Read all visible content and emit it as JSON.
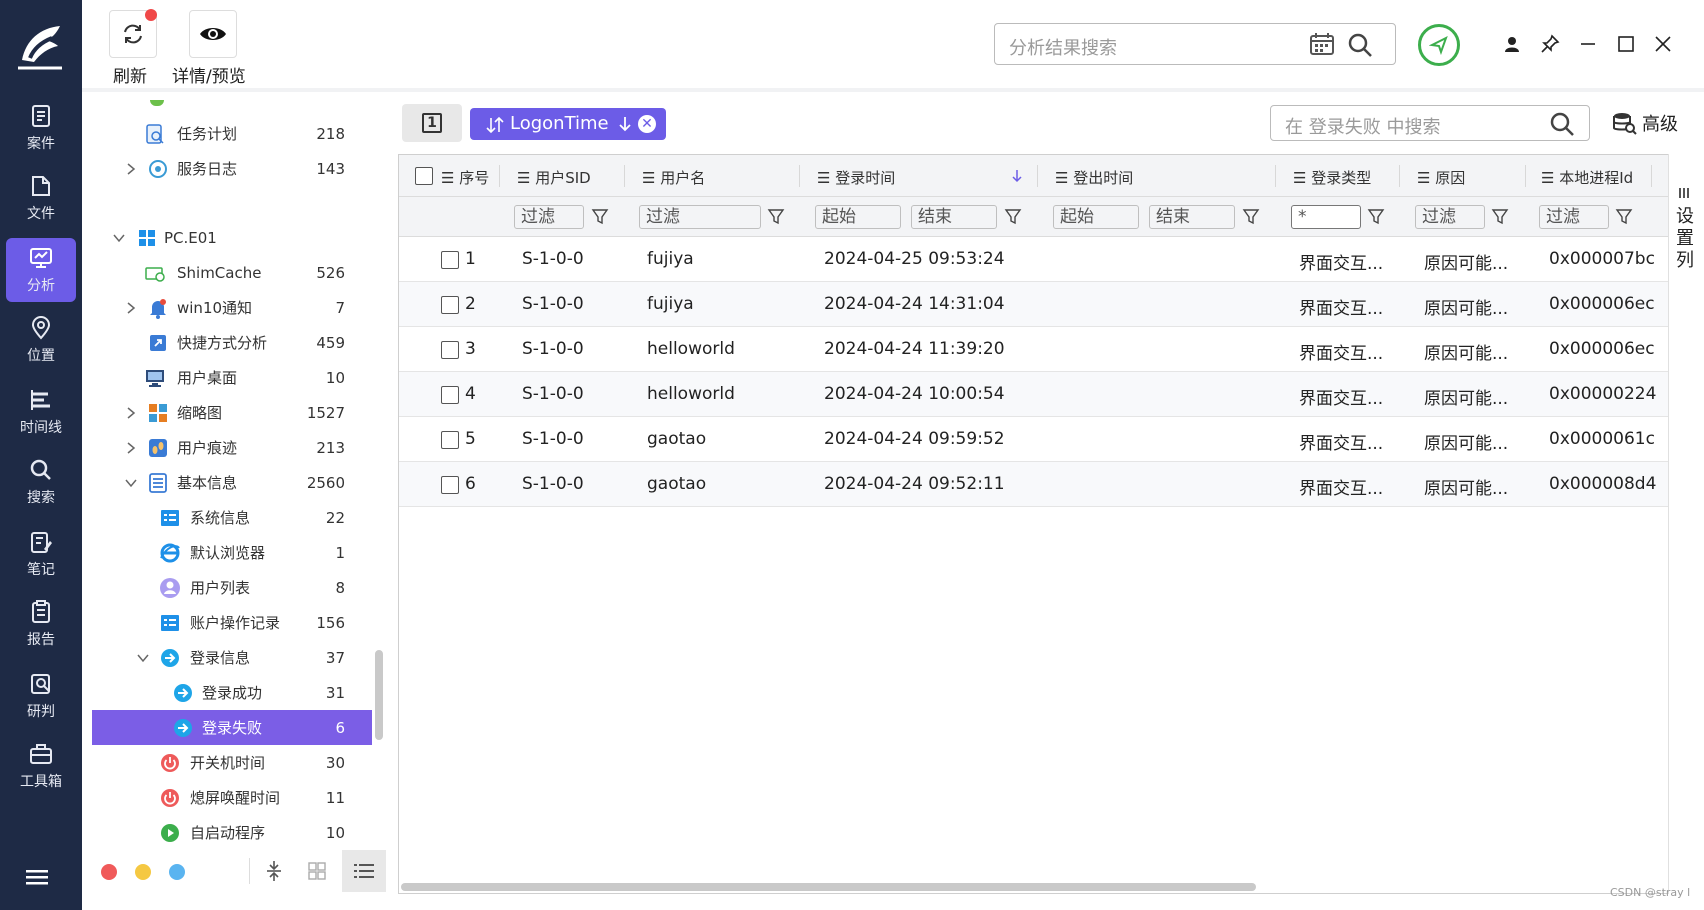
{
  "nav": {
    "items": [
      {
        "label": "案件",
        "icon": "case-icon"
      },
      {
        "label": "文件",
        "icon": "folder-icon"
      },
      {
        "label": "分析",
        "icon": "analysis-icon",
        "active": true
      },
      {
        "label": "位置",
        "icon": "location-icon"
      },
      {
        "label": "时间线",
        "icon": "timeline-icon"
      },
      {
        "label": "搜索",
        "icon": "search-icon"
      },
      {
        "label": "笔记",
        "icon": "note-icon"
      },
      {
        "label": "报告",
        "icon": "report-icon"
      },
      {
        "label": "研判",
        "icon": "judge-icon"
      },
      {
        "label": "工具箱",
        "icon": "toolbox-icon"
      }
    ]
  },
  "toolbar": {
    "refresh_label": "刷新",
    "detail_label": "详情/预览",
    "search_placeholder": "分析结果搜索"
  },
  "tree": {
    "items": [
      {
        "label": "任务计划",
        "count": "218"
      },
      {
        "label": "服务日志",
        "count": "143"
      },
      {
        "label": "PC.E01",
        "count": ""
      },
      {
        "label": "ShimCache",
        "count": "526"
      },
      {
        "label": "win10通知",
        "count": "7"
      },
      {
        "label": "快捷方式分析",
        "count": "459"
      },
      {
        "label": "用户桌面",
        "count": "10"
      },
      {
        "label": "缩略图",
        "count": "1527"
      },
      {
        "label": "用户痕迹",
        "count": "213"
      },
      {
        "label": "基本信息",
        "count": "2560"
      },
      {
        "label": "系统信息",
        "count": "22"
      },
      {
        "label": "默认浏览器",
        "count": "1"
      },
      {
        "label": "用户列表",
        "count": "8"
      },
      {
        "label": "账户操作记录",
        "count": "156"
      },
      {
        "label": "登录信息",
        "count": "37"
      },
      {
        "label": "登录成功",
        "count": "31"
      },
      {
        "label": "登录失败",
        "count": "6"
      },
      {
        "label": "开关机时间",
        "count": "30"
      },
      {
        "label": "熄屏唤醒时间",
        "count": "11"
      },
      {
        "label": "自启动程序",
        "count": "10"
      }
    ]
  },
  "filterbar": {
    "page_num": "1",
    "chip_label": "LogonTime",
    "search_placeholder": "在 登录失败 中搜索",
    "advanced_label": "高级"
  },
  "table": {
    "headers": [
      "序号",
      "用户SID",
      "用户名",
      "登录时间",
      "登出时间",
      "登录类型",
      "原因",
      "本地进程Id"
    ],
    "filters": {
      "filter": "过滤",
      "start": "起始",
      "end": "结束",
      "type_value": "*"
    },
    "rows": [
      {
        "no": "1",
        "sid": "S-1-0-0",
        "user": "fujiya",
        "login": "2024-04-25 09:53:24",
        "logout": "",
        "type": "界面交互...",
        "reason": "原因可能...",
        "pid": "0x000007bc"
      },
      {
        "no": "2",
        "sid": "S-1-0-0",
        "user": "fujiya",
        "login": "2024-04-24 14:31:04",
        "logout": "",
        "type": "界面交互...",
        "reason": "原因可能...",
        "pid": "0x000006ec"
      },
      {
        "no": "3",
        "sid": "S-1-0-0",
        "user": "helloworld",
        "login": "2024-04-24 11:39:20",
        "logout": "",
        "type": "界面交互...",
        "reason": "原因可能...",
        "pid": "0x000006ec"
      },
      {
        "no": "4",
        "sid": "S-1-0-0",
        "user": "helloworld",
        "login": "2024-04-24 10:00:54",
        "logout": "",
        "type": "界面交互...",
        "reason": "原因可能...",
        "pid": "0x00000224"
      },
      {
        "no": "5",
        "sid": "S-1-0-0",
        "user": "gaotao",
        "login": "2024-04-24 09:59:52",
        "logout": "",
        "type": "界面交互...",
        "reason": "原因可能...",
        "pid": "0x0000061c"
      },
      {
        "no": "6",
        "sid": "S-1-0-0",
        "user": "gaotao",
        "login": "2024-04-24 09:52:11",
        "logout": "",
        "type": "界面交互...",
        "reason": "原因可能...",
        "pid": "0x000008d4"
      }
    ]
  },
  "settings_column_label": "设置列",
  "watermark": "CSDN @stray l",
  "colors": {
    "nav_bg": "#1e2a45",
    "accent": "#6c5ce7",
    "green": "#3cae4c"
  }
}
